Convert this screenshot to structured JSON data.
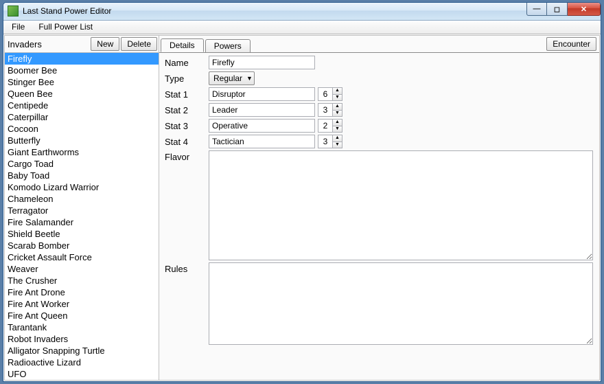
{
  "window": {
    "title": "Last Stand Power Editor"
  },
  "menu": {
    "file": "File",
    "full_power_list": "Full Power List"
  },
  "left": {
    "heading": "Invaders",
    "new_btn": "New",
    "delete_btn": "Delete",
    "items": [
      "Firefly",
      "Boomer Bee",
      "Stinger Bee",
      "Queen Bee",
      "Centipede",
      "Caterpillar",
      "Cocoon",
      "Butterfly",
      "Giant Earthworms",
      "Cargo Toad",
      "Baby Toad",
      "Komodo Lizard Warrior",
      "Chameleon",
      "Terragator",
      "Fire Salamander",
      "Shield Beetle",
      "Scarab Bomber",
      "Cricket Assault Force",
      "Weaver",
      "The Crusher",
      "Fire Ant Drone",
      "Fire Ant Worker",
      "Fire Ant Queen",
      "Tarantank",
      "Robot Invaders",
      "Alligator Snapping Turtle",
      "Radioactive Lizard",
      "UFO"
    ],
    "selected_index": 0
  },
  "tabs": {
    "details": "Details",
    "powers": "Powers",
    "encounter": "Encounter"
  },
  "details": {
    "labels": {
      "name": "Name",
      "type": "Type",
      "stat1": "Stat 1",
      "stat2": "Stat 2",
      "stat3": "Stat 3",
      "stat4": "Stat 4",
      "flavor": "Flavor",
      "rules": "Rules"
    },
    "name_value": "Firefly",
    "type_value": "Regular",
    "stats": [
      {
        "label": "Disruptor",
        "value": "6"
      },
      {
        "label": "Leader",
        "value": "3"
      },
      {
        "label": "Operative",
        "value": "2"
      },
      {
        "label": "Tactician",
        "value": "3"
      }
    ],
    "flavor_text": "",
    "rules_text": ""
  }
}
